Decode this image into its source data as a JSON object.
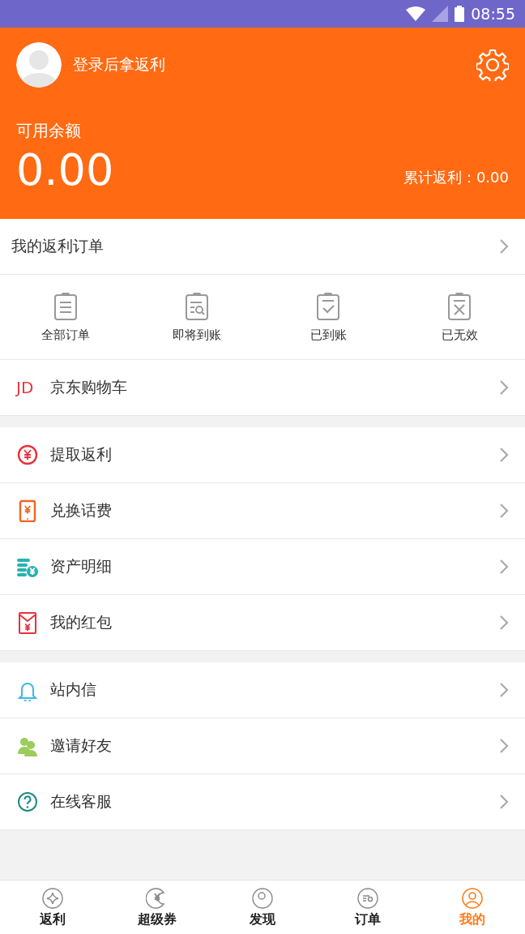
{
  "status_bar": {
    "time": "08:55"
  },
  "header": {
    "login_text": "登录后拿返利",
    "balance_label": "可用余额",
    "balance": "0.00",
    "total_rebate": "累计返利：0.00"
  },
  "orders": {
    "title": "我的返利订单",
    "items": [
      {
        "label": "全部订单"
      },
      {
        "label": "即将到账"
      },
      {
        "label": "已到账"
      },
      {
        "label": "已无效"
      }
    ]
  },
  "sections": [
    [
      {
        "label": "京东购物车",
        "kind": "logo",
        "logo": "JD"
      }
    ],
    [
      {
        "label": "提取返利",
        "kind": "icon"
      },
      {
        "label": "兑换话费",
        "kind": "icon"
      },
      {
        "label": "资产明细",
        "kind": "icon"
      },
      {
        "label": "我的红包",
        "kind": "icon"
      }
    ],
    [
      {
        "label": "站内信",
        "kind": "icon"
      },
      {
        "label": "邀请好友",
        "kind": "icon"
      },
      {
        "label": "在线客服",
        "kind": "icon"
      }
    ]
  ],
  "tab_bar": [
    {
      "label": "返利",
      "selected": false
    },
    {
      "label": "超级券",
      "selected": false
    },
    {
      "label": "发现",
      "selected": false
    },
    {
      "label": "订单",
      "selected": false
    },
    {
      "label": "我的",
      "selected": true
    }
  ]
}
